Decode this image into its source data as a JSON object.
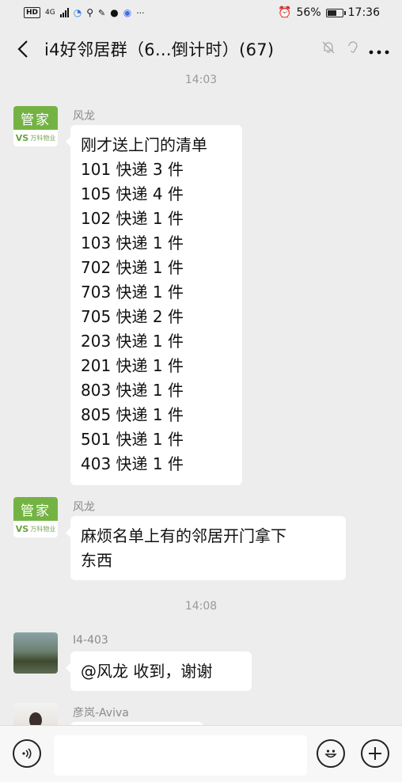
{
  "status_bar": {
    "network": "4G",
    "battery_pct": "56%",
    "time": "17:36"
  },
  "header": {
    "back_icon": "chevron-left-icon",
    "title": "i4好邻居群（6...倒计时）(67)",
    "more_icon": "more-dots-icon"
  },
  "messages": {
    "t1": "14:03",
    "m1": {
      "avatar_text": "管家",
      "avatar_sub": "万科物业",
      "sender": "风龙",
      "lines": [
        "刚才送上门的清单",
        "101 快递 3 件",
        "105 快递 4 件",
        "102 快递 1 件",
        "103 快递 1 件",
        "702 快递 1 件",
        "703 快递 1 件",
        "705 快递 2 件",
        "203 快递 1 件",
        "201 快递 1 件",
        "803 快递 1 件",
        "805 快递 1 件",
        "501 快递 1 件",
        "403 快递 1 件"
      ]
    },
    "m2": {
      "avatar_text": "管家",
      "avatar_sub": "万科物业",
      "sender": "风龙",
      "lines": [
        "麻烦名单上有的邻居开门拿下",
        "东西"
      ]
    },
    "t2": "14:08",
    "m3": {
      "sender": "I4-403",
      "text": "@风龙  收到，谢谢"
    },
    "m4": {
      "sender": "彦岚-Aviva"
    }
  },
  "input_bar": {
    "voice_icon": "voice-icon",
    "emoji_icon": "emoji-icon",
    "plus_icon": "plus-icon"
  }
}
